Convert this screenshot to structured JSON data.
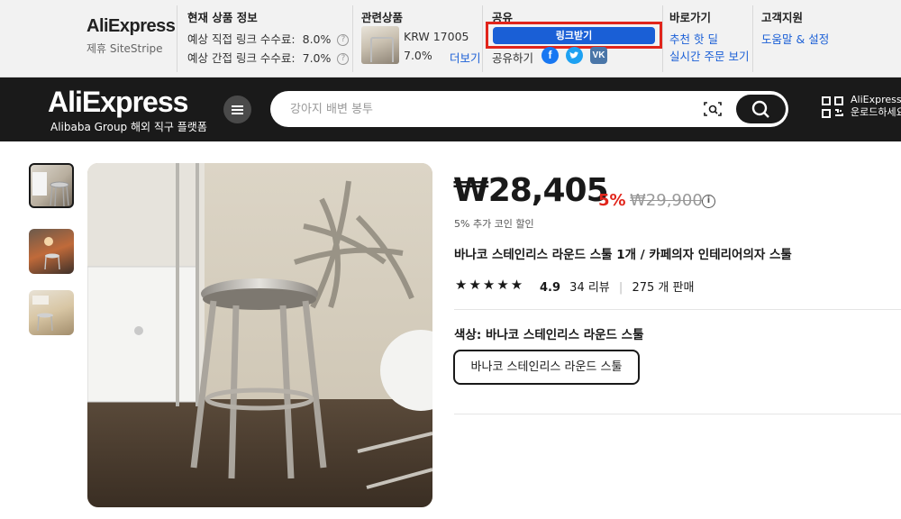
{
  "sitestripe": {
    "brand": "AliExpress",
    "brand_sub": "제휴 SiteStripe",
    "product_info": {
      "title": "현재 상품 정보",
      "direct_label": "예상 직접 링크 수수료:",
      "direct_value": "8.0%",
      "indirect_label": "예상 간접 링크 수수료:",
      "indirect_value": "7.0%"
    },
    "related": {
      "title": "관련상품",
      "price": "KRW 17005",
      "rate": "7.0%",
      "more": "더보기"
    },
    "share": {
      "title": "공유",
      "button": "링크받기",
      "share_label": "공유하기",
      "icons": [
        "facebook-icon",
        "twitter-icon",
        "vk-icon"
      ]
    },
    "shortcuts": {
      "title": "바로가기",
      "links": [
        "추천 핫 딜",
        "실시간 주문 보기"
      ]
    },
    "support": {
      "title": "고객지원",
      "link": "도움말 & 설정"
    }
  },
  "header": {
    "logo": "AliExpress",
    "logo_sub": "Alibaba Group 해외 직구 플랫폼",
    "search_placeholder": "강아지 배변 봉투",
    "app_line1": "AliExpress",
    "app_line2": "운로드하세요"
  },
  "product": {
    "price": "₩28,405",
    "discount": "5%",
    "old_price": "₩29,900",
    "coin_text": "5% 추가 코인 할인",
    "title": "바나코 스테인리스 라운드 스툴 1개 / 카페의자 인테리어의자 스툴",
    "stars": "★★★★★",
    "rating": "4.9",
    "reviews": "34 리뷰",
    "sold": "275 개 판매",
    "color_label": "색상: 바나코 스테인리스 라운드 스툴",
    "sku_option": "바나코 스테인리스 라운드 스툴"
  },
  "colors": {
    "accent_blue": "#1a5fd6",
    "highlight_red": "#e1251b",
    "header_bg": "#1a1a1a",
    "facebook": "#1877f2",
    "twitter": "#1da1f2",
    "vk": "#4a76a8"
  }
}
